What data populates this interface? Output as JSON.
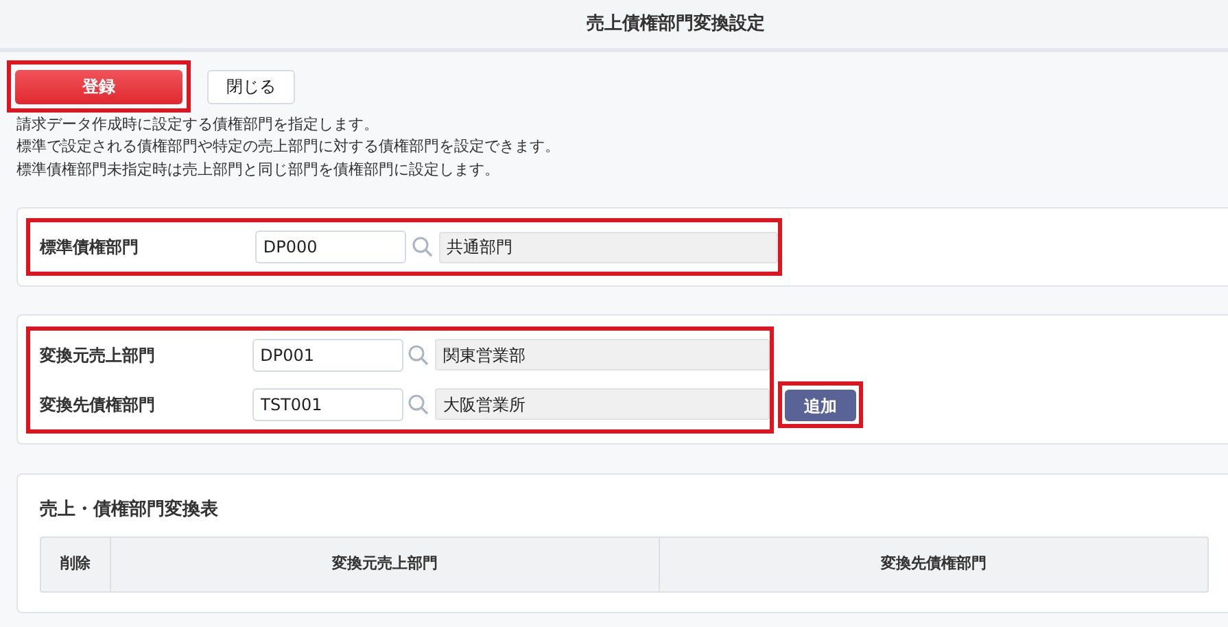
{
  "title": "売上債権部門変換設定",
  "buttons": [
    {
      "label": "登録",
      "kind": "primary",
      "highlighted": true
    },
    {
      "label": "閉じる",
      "kind": "secondary",
      "highlighted": false
    }
  ],
  "description": [
    "請求データ作成時に設定する債権部門を指定します。",
    "標準で設定される債権部門や特定の売上部門に対する債権部門を設定できます。",
    "標準債権部門未指定時は売上部門と同じ部門を債権部門に設定します。"
  ],
  "default_section": {
    "highlighted": true,
    "rows": [
      {
        "label": "標準債権部門",
        "code": "DP000",
        "name": "共通部門"
      }
    ]
  },
  "conversion_section": {
    "highlighted": true,
    "rows": [
      {
        "label": "変換元売上部門",
        "code": "DP001",
        "name": "関東営業部"
      },
      {
        "label": "変換先債権部門",
        "code": "TST001",
        "name": "大阪営業所"
      }
    ],
    "add_button": {
      "label": "追加",
      "highlighted": true
    }
  },
  "table": {
    "title": "売上・債権部門変換表",
    "columns": [
      "削除",
      "変換元売上部門",
      "変換先債権部門"
    ]
  }
}
